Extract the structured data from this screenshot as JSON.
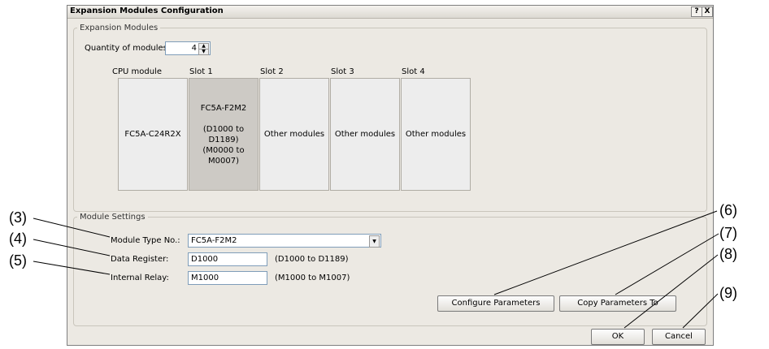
{
  "window": {
    "title": "Expansion Modules Configuration",
    "help": "?",
    "close": "X"
  },
  "expansion": {
    "legend": "Expansion Modules",
    "quantity_label": "Quantity of modules:",
    "quantity_value": "4",
    "columns": [
      {
        "header": "CPU module",
        "body": "FC5A-C24R2X"
      },
      {
        "header": "Slot 1",
        "body": "FC5A-F2M2\n\n(D1000 to D1189)\n(M0000 to M0007)"
      },
      {
        "header": "Slot 2",
        "body": "Other modules"
      },
      {
        "header": "Slot 3",
        "body": "Other modules"
      },
      {
        "header": "Slot 4",
        "body": "Other modules"
      }
    ]
  },
  "settings": {
    "legend": "Module Settings",
    "type_label": "Module Type No.:",
    "type_value": "FC5A-F2M2",
    "dr_label": "Data Register:",
    "dr_value": "D1000",
    "dr_range": "(D1000 to D1189)",
    "ir_label": "Internal Relay:",
    "ir_value": "M1000",
    "ir_range": "(M1000 to M1007)",
    "configure_button": "Configure Parameters",
    "copy_button": "Copy Parameters To"
  },
  "footer": {
    "ok": "OK",
    "cancel": "Cancel"
  },
  "callouts": {
    "c3": "(3)",
    "c4": "(4)",
    "c5": "(5)",
    "c6": "(6)",
    "c7": "(7)",
    "c8": "(8)",
    "c9": "(9)"
  }
}
